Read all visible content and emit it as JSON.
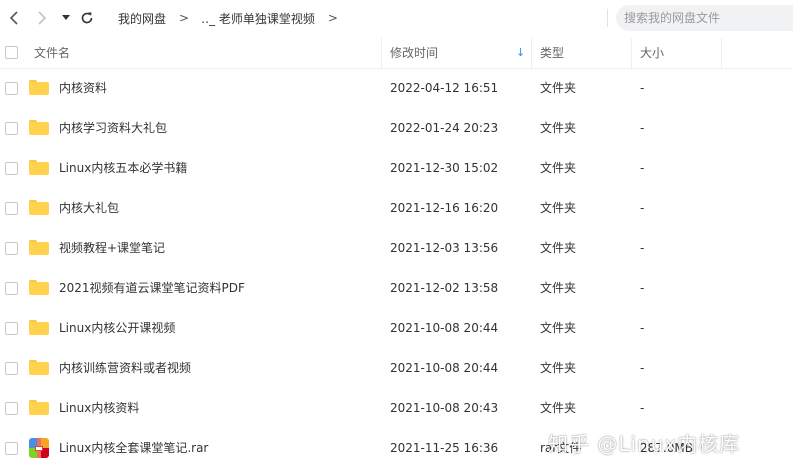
{
  "nav": {
    "back_icon": "chevron-left-icon",
    "forward_icon": "chevron-right-icon",
    "dropdown_icon": "caret-down-icon",
    "refresh_icon": "refresh-icon"
  },
  "breadcrumb": {
    "root": "我的网盘",
    "sep1": ">",
    "current": "‥_ 老师单独课堂视频",
    "sep2": ">"
  },
  "search": {
    "placeholder": "搜索我的网盘文件"
  },
  "columns": {
    "name": "文件名",
    "modified": "修改时间",
    "type": "类型",
    "size": "大小"
  },
  "sort": {
    "column": "modified",
    "direction": "desc",
    "icon": "sort-down-arrow-icon",
    "glyph": "↓"
  },
  "files": [
    {
      "name": "内核资料",
      "modified": "2022-04-12 16:51",
      "type": "文件夹",
      "size": "-",
      "icon": "folder-icon"
    },
    {
      "name": "内核学习资料大礼包",
      "modified": "2022-01-24 20:23",
      "type": "文件夹",
      "size": "-",
      "icon": "folder-icon"
    },
    {
      "name": "Linux内核五本必学书籍",
      "modified": "2021-12-30 15:02",
      "type": "文件夹",
      "size": "-",
      "icon": "folder-icon"
    },
    {
      "name": "内核大礼包",
      "modified": "2021-12-16 16:20",
      "type": "文件夹",
      "size": "-",
      "icon": "folder-icon"
    },
    {
      "name": "视频教程+课堂笔记",
      "modified": "2021-12-03 13:56",
      "type": "文件夹",
      "size": "-",
      "icon": "folder-icon"
    },
    {
      "name": "2021视频有道云课堂笔记资料PDF",
      "modified": "2021-12-02 13:58",
      "type": "文件夹",
      "size": "-",
      "icon": "folder-icon"
    },
    {
      "name": "Linux内核公开课视频",
      "modified": "2021-10-08 20:44",
      "type": "文件夹",
      "size": "-",
      "icon": "folder-icon"
    },
    {
      "name": "内核训练营资料或者视频",
      "modified": "2021-10-08 20:44",
      "type": "文件夹",
      "size": "-",
      "icon": "folder-icon"
    },
    {
      "name": "Linux内核资料",
      "modified": "2021-10-08 20:43",
      "type": "文件夹",
      "size": "-",
      "icon": "folder-icon"
    },
    {
      "name": "Linux内核全套课堂笔记.rar",
      "modified": "2021-11-25 16:36",
      "type": "rar文件",
      "size": "287.0MB",
      "icon": "rar-archive-icon"
    }
  ],
  "watermark": {
    "text": "知乎 @Linux内核库"
  },
  "colors": {
    "folder": "#ffd34e",
    "accent": "#2e8ef6",
    "rar_top_left": "#4a90e2",
    "rar_top_right": "#f5a623",
    "rar_bottom_left": "#7ed321",
    "rar_bottom_right": "#d0021b"
  }
}
